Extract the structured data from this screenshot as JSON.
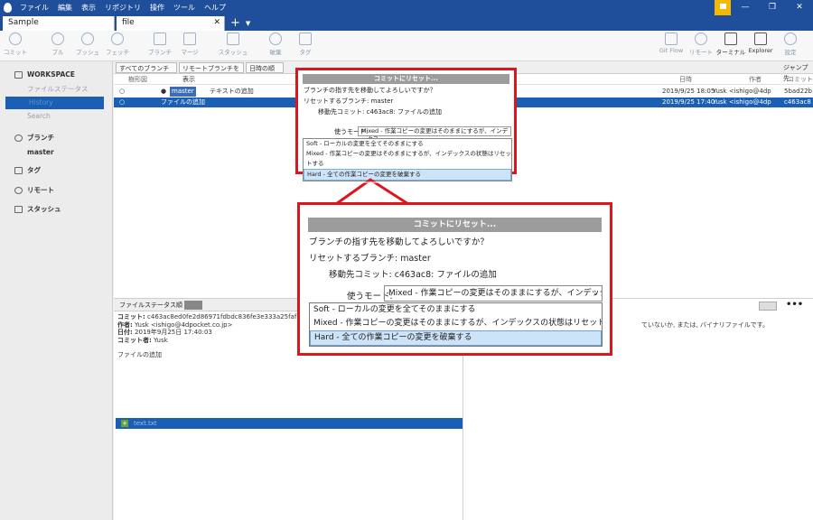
{
  "menu": [
    "ファイル",
    "編集",
    "表示",
    "リポジトリ",
    "操作",
    "ツール",
    "ヘルプ"
  ],
  "window": {
    "min": "—",
    "max": "❐",
    "close": "✕"
  },
  "tabs": [
    {
      "label": "Sample"
    },
    {
      "label": "file"
    }
  ],
  "tab_plus": "+",
  "tab_caret": "▼",
  "toolbar": {
    "commit": "コミット",
    "pull": "プル",
    "push": "プッシュ",
    "fetch": "フェッチ",
    "branch": "ブランチ",
    "merge": "マージ",
    "stash": "スタッシュ",
    "discard": "破棄",
    "tag": "タグ",
    "gitflow": "Git Flow",
    "remote": "リモート",
    "terminal": "ターミナル",
    "explorer": "Explorer",
    "settings": "設定"
  },
  "sidebar": {
    "workspace": "WORKSPACE",
    "file_status": "ファイルステータス",
    "history": "History",
    "search": "Search",
    "branches": "ブランチ",
    "master": "master",
    "tags": "タグ",
    "remotes": "リモート",
    "stashes": "スタッシュ"
  },
  "filter": {
    "all_branches": "すべてのブランチ",
    "show_remote": "リモートブランチを表示",
    "date_order": "日時の順",
    "jump": "ジャンプ先:"
  },
  "columns": {
    "graph": "樹形図",
    "date": "日時",
    "author": "作者",
    "commit": "コミット"
  },
  "commits": [
    {
      "branch": "master",
      "message": "テキストの追加",
      "date": "2019/9/25 18:05",
      "author": "Yusk <ishigo@4dp",
      "hash": "5bad22b"
    },
    {
      "message": "ファイルの追加",
      "date": "2019/9/25 17:40",
      "author": "Yusk <ishigo@4dp",
      "hash": "c463ac8"
    }
  ],
  "file_status_bar": "ファイルステータス順",
  "detail": {
    "commit_label": "コミット:",
    "commit_value": "c463ac8ed0fe2d86971fdbdc836fe3e333a25faf [c463",
    "author_label": "作者:",
    "author_value": "Yusk <ishigo@4dpocket.co.jp>",
    "date_label": "日付:",
    "date_value": "2019年9月25日 17:40:03",
    "committer_label": "コミット者:",
    "committer_value": "Yusk",
    "message": "ファイルの追加"
  },
  "file_row": {
    "name": "text.txt",
    "badge": "+"
  },
  "right_info": "ていないか, または, バイナリファイルです。",
  "more_icon": "•••",
  "dialog": {
    "title": "コミットにリセット...",
    "question": "ブランチの指す先を移動してよろしいですか？",
    "branch_label": "リセットするブランチ:",
    "branch_value": "master",
    "target_label": "移動先コミット:",
    "target_value": "c463ac8: ファイルの追加",
    "mode_label": "使うモード:",
    "mode_selected": "Mixed - 作業コピーの変更はそのままにするが、インデックス",
    "mode_selected_big": "Mixed - 作業コピーの変更はそのままにするが、インデックス",
    "options": [
      "Soft - ローカルの変更を全てそのままにする",
      "Mixed - 作業コピーの変更はそのままにするが、インデックスの状態はリセットする",
      "Hard - 全ての作業コピーの変更を破棄する"
    ],
    "chevron": "⌄"
  },
  "colors": {
    "accent": "#1f4f9b",
    "selection": "#1a5fb4",
    "highlight_border": "#e0141c"
  }
}
